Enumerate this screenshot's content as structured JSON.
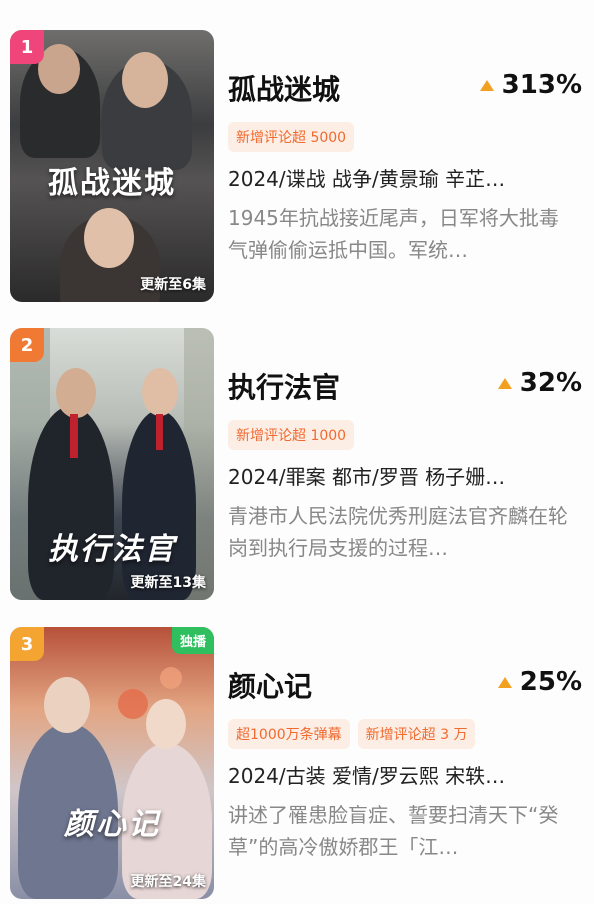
{
  "items": [
    {
      "rank": "1",
      "title": "孤战迷城",
      "growth": "313%",
      "tags": [
        "新增评论超 5000"
      ],
      "meta": "2024/谍战 战争/黄景瑜 辛芷…",
      "desc": "1945年抗战接近尾声，日军将大批毒气弹偷偷运抵中国。军统…",
      "poster_title": "孤战迷城",
      "update": "更新至6集"
    },
    {
      "rank": "2",
      "title": "执行法官",
      "growth": "32%",
      "tags": [
        "新增评论超 1000"
      ],
      "meta": "2024/罪案 都市/罗晋 杨子姗…",
      "desc": "青港市人民法院优秀刑庭法官齐麟在轮岗到执行局支援的过程…",
      "poster_title": "执行法官",
      "update": "更新至13集"
    },
    {
      "rank": "3",
      "badge": "独播",
      "title": "颜心记",
      "growth": "25%",
      "tags": [
        "超1000万条弹幕",
        "新增评论超 3 万"
      ],
      "meta": "2024/古装 爱情/罗云熙 宋轶…",
      "desc": "讲述了罹患脸盲症、誓要扫清天下“癸草”的高冷傲娇郡王「江…",
      "poster_title": "颜心记",
      "update": "更新至24集"
    }
  ],
  "colors": {
    "rank1": "#f0457a",
    "rank2": "#f07a33",
    "rank3": "#f4a431",
    "exclusive": "#2fbf5f",
    "tag_bg": "#fdeee5",
    "tag_text": "#f06a2f",
    "growth_arrow": "#f2a020"
  },
  "icons": {
    "growth": "arrow-up-icon"
  }
}
